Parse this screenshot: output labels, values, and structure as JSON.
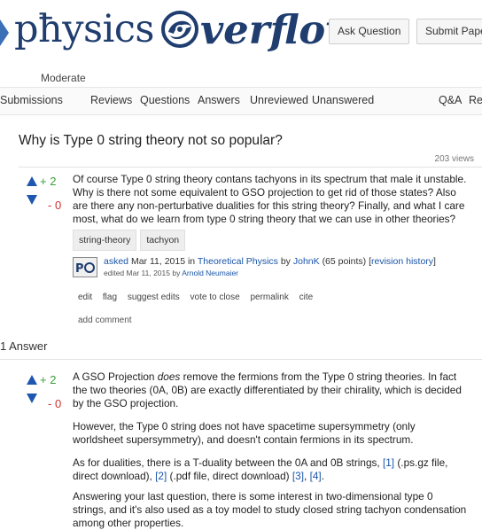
{
  "header": {
    "logo_physics": "pħysics",
    "logo_verflow": "verflow",
    "ask_question": "Ask Question",
    "submit_paper": "Submit Paper"
  },
  "subnav": {
    "moderate": "Moderate"
  },
  "nav": {
    "items": [
      "Submissions",
      "Reviews",
      "Questions",
      "Answers",
      "Unreviewed",
      "Unanswered"
    ],
    "right_items": [
      "Q&A",
      "Re"
    ]
  },
  "question": {
    "title": "Why is Type 0 string theory not so popular?",
    "views": "203 views",
    "vote_up": "+ 2",
    "vote_down": "- 0",
    "body": "Of course Type 0 string theory contans tachyons in its spectrum that male it unstable. Why is there not some equivalent to GSO projection to get rid of those states? Also are there any non-perturbative dualities for this string theory? Finally, and what I care most, what do we learn from type 0 string theory that we can use in other theories?",
    "tags": [
      "string-theory",
      "tachyon"
    ],
    "meta": {
      "asked": "asked",
      "date_text": "Mar 11, 2015 in",
      "category": "Theoretical Physics",
      "by": "by",
      "author": "JohnK",
      "points": "(65 points)",
      "revision": "revision history",
      "edited_text": "edited Mar 11, 2015 by",
      "editor": "Arnold Neumaier"
    },
    "actions": [
      "edit",
      "flag",
      "suggest edits",
      "vote to close",
      "permalink",
      "cite"
    ],
    "add_comment": "add comment"
  },
  "answers": {
    "heading": "1 Answer",
    "vote_up": "+ 2",
    "vote_down": "- 0",
    "p1_start": "A GSO Projection ",
    "p1_em": "does",
    "p1_end": " remove the fermions from the Type 0 string theories. In fact the two theories (0A, 0B) are exactly differentiated by their chirality, which is decided by the GSO projection.",
    "p2": "However, the Type 0 string does not have spacetime supersymmetry (only worldsheet supersymmetry), and doesn't contain fermions in its spectrum.",
    "p3_start": "As for dualities, there is a T-duality between the 0A and 0B strings, ",
    "p3_link1": "[1]",
    "p3_mid": " (.ps.gz file, direct download), ",
    "p3_link2": "[2]",
    "p3_mid2": " (.pdf file, direct download) ",
    "p3_link3": "[3]",
    "p3_comma": ", ",
    "p3_link4": "[4]",
    "p3_end": ".",
    "p4": "Answering your last question, there is some interest in two-dimensional type 0 strings, and it's also used as a toy model to study closed string tachyon condensation among other properties."
  },
  "colors": {
    "logo": "#1f3d6e",
    "vote_arrow": "#1e56b0",
    "up_count": "#3aa13a",
    "down_count": "#d03030",
    "link": "#1a55a8"
  }
}
